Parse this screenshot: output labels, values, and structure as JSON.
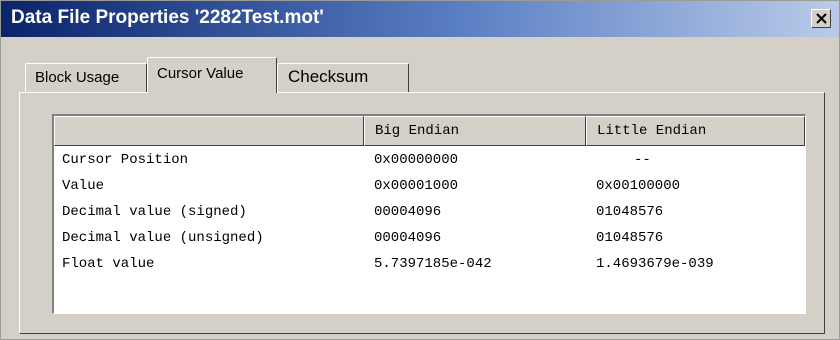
{
  "window": {
    "title": "Data File Properties '2282Test.mot'"
  },
  "icons": {
    "close": "close-x-icon"
  },
  "tabs": [
    {
      "label": "Block Usage",
      "active": false
    },
    {
      "label": "Cursor Value",
      "active": true
    },
    {
      "label": "Checksum",
      "active": false
    }
  ],
  "table": {
    "columns": [
      "",
      "Big Endian",
      "Little Endian"
    ],
    "rows": [
      [
        "Cursor Position",
        "0x00000000",
        "--"
      ],
      [
        "Value",
        "0x00001000",
        "0x00100000"
      ],
      [
        "Decimal value (signed)",
        "00004096",
        "01048576"
      ],
      [
        "Decimal value (unsigned)",
        "00004096",
        "01048576"
      ],
      [
        "Float value",
        "5.7397185e-042",
        "1.4693679e-039"
      ]
    ]
  },
  "colors": {
    "title_gradient_start": "#0a246a",
    "title_gradient_end": "#b9cbe8",
    "face": "#d4d0c8"
  }
}
